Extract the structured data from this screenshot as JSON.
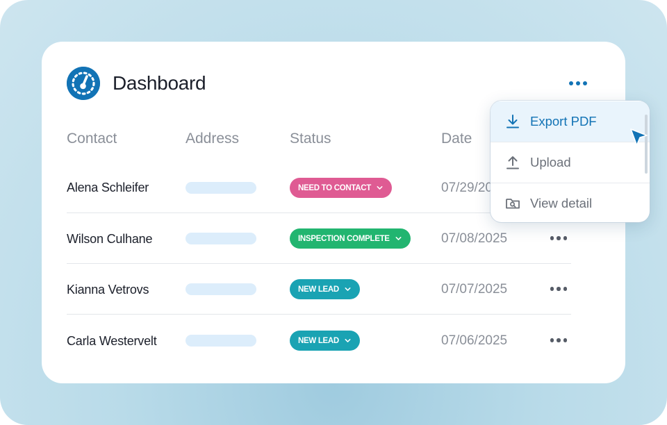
{
  "header": {
    "title": "Dashboard",
    "logo_icon": "gauge-icon",
    "more_icon": "more-horizontal-icon"
  },
  "columns": [
    "Contact",
    "Address",
    "Status",
    "Date"
  ],
  "rows": [
    {
      "contact": "Alena Schleifer",
      "status": "NEED TO CONTACT",
      "status_color": "#df5b93",
      "date": "07/29/2025"
    },
    {
      "contact": "Wilson Culhane",
      "status": "INSPECTION COMPLETE",
      "status_color": "#22b570",
      "date": "07/08/2025"
    },
    {
      "contact": "Kianna Vetrovs",
      "status": "NEW LEAD",
      "status_color": "#1aa3b3",
      "date": "07/07/2025"
    },
    {
      "contact": "Carla Westervelt",
      "status": "NEW LEAD",
      "status_color": "#1aa3b3",
      "date": "07/06/2025"
    }
  ],
  "menu": {
    "items": [
      {
        "label": "Export PDF",
        "icon": "download-icon",
        "active": true
      },
      {
        "label": "Upload",
        "icon": "upload-icon",
        "active": false
      },
      {
        "label": "View detail",
        "icon": "folder-search-icon",
        "active": false
      }
    ]
  },
  "colors": {
    "accent": "#1273b5",
    "menu_active_bg": "#e9f4fc",
    "address_placeholder": "#dcedfb",
    "text_muted": "#8a8f98"
  }
}
